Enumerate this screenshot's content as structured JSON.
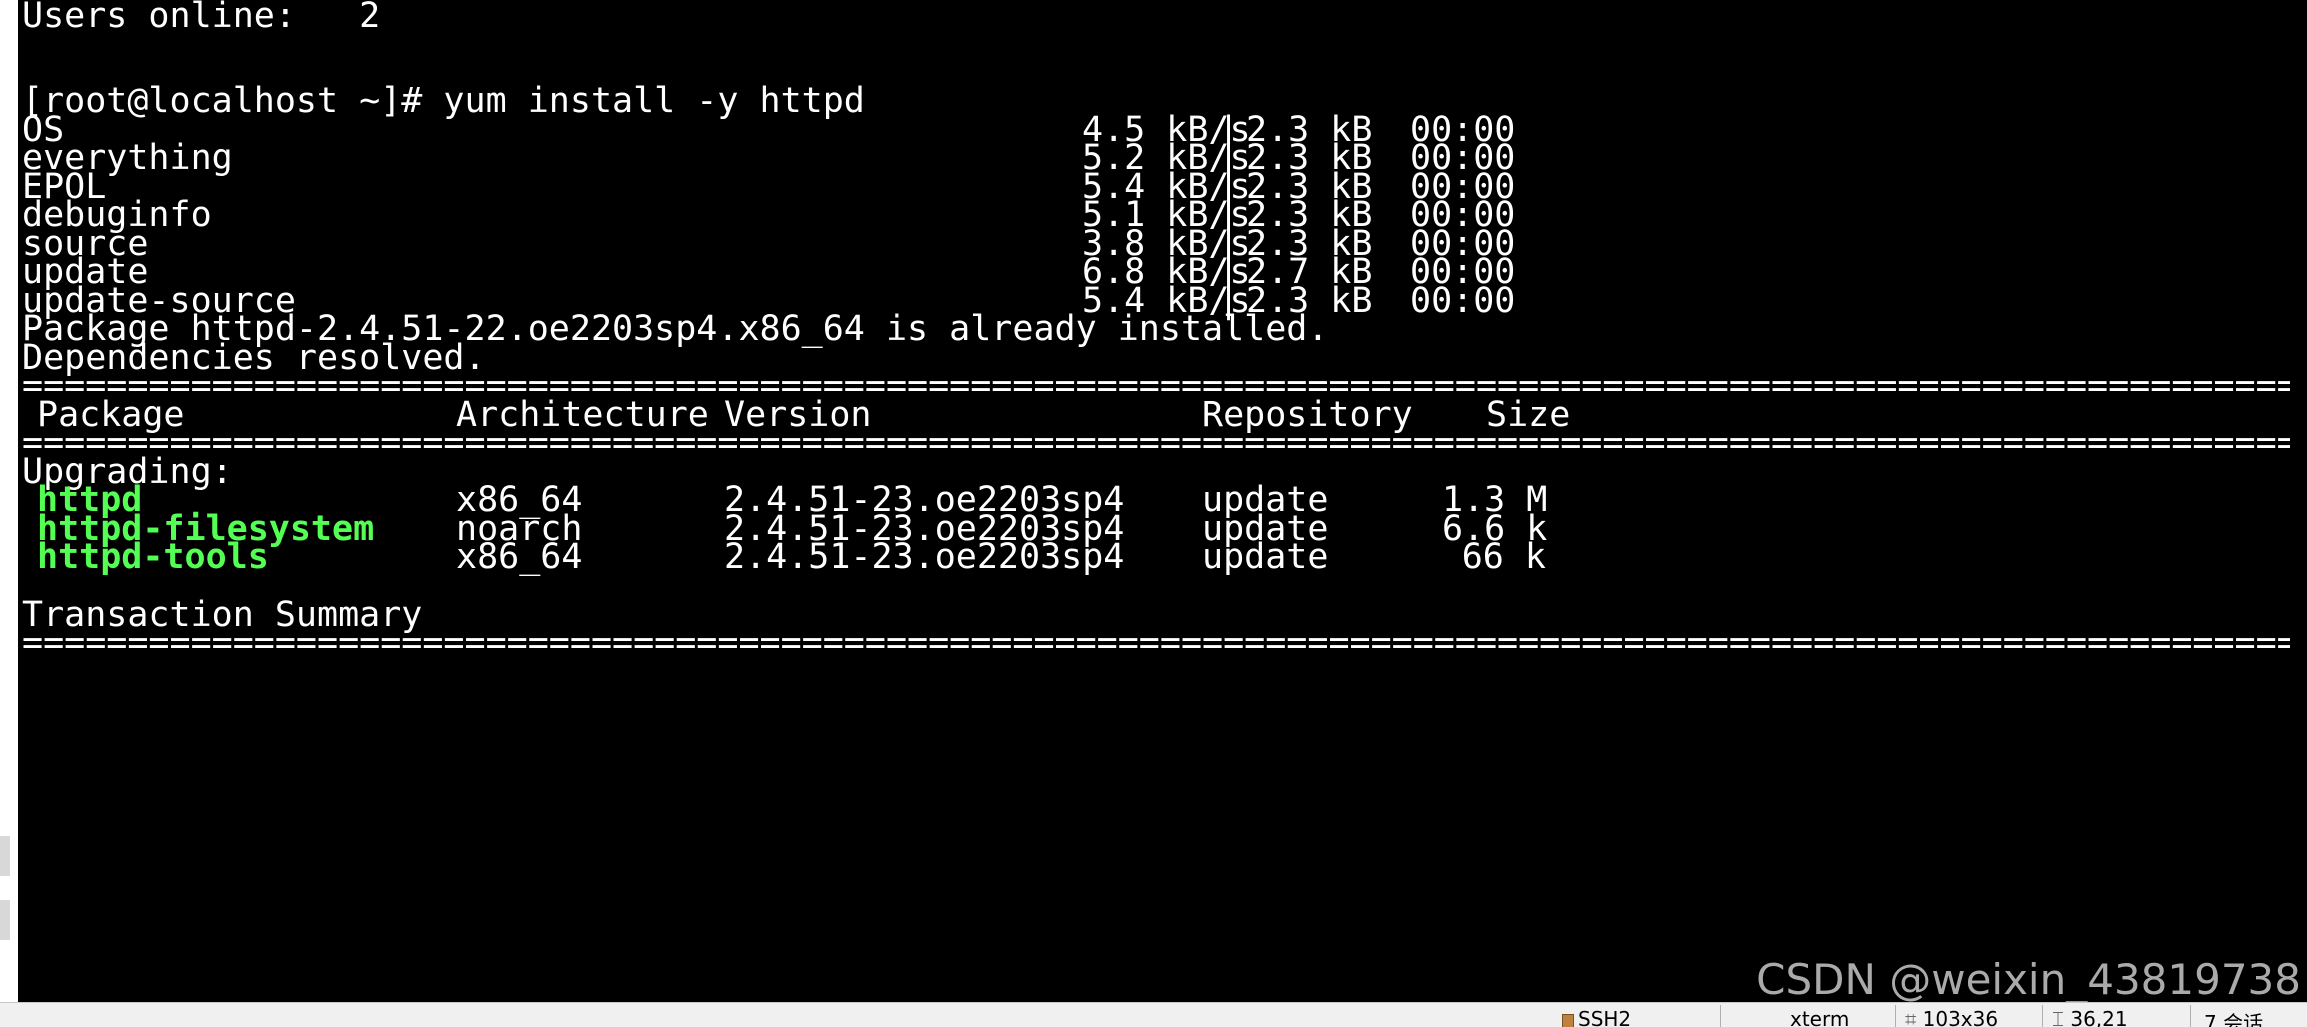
{
  "terminal": {
    "users_online": "Users online:   2",
    "prompt": "[root@localhost ~]# yum install -y httpd",
    "repos": [
      {
        "name": "OS",
        "speed": "4.5 kB/s",
        "size": "2.3 kB",
        "time": "00:00"
      },
      {
        "name": "everything",
        "speed": "5.2 kB/s",
        "size": "2.3 kB",
        "time": "00:00"
      },
      {
        "name": "EPOL",
        "speed": "5.4 kB/s",
        "size": "2.3 kB",
        "time": "00:00"
      },
      {
        "name": "debuginfo",
        "speed": "5.1 kB/s",
        "size": "2.3 kB",
        "time": "00:00"
      },
      {
        "name": "source",
        "speed": "3.8 kB/s",
        "size": "2.3 kB",
        "time": "00:00"
      },
      {
        "name": "update",
        "speed": "6.8 kB/s",
        "size": "2.7 kB",
        "time": "00:00"
      },
      {
        "name": "update-source",
        "speed": "5.4 kB/s",
        "size": "2.3 kB",
        "time": "00:00"
      }
    ],
    "separator": "|",
    "already_installed": "Package httpd-2.4.51-22.oe2203sp4.x86_64 is already installed.",
    "deps_resolved": "Dependencies resolved.",
    "rule": "==================================================================================================================",
    "table_headers": {
      "package": "Package",
      "architecture": "Architecture",
      "version": "Version",
      "repository": "Repository",
      "size": "Size"
    },
    "upgrading_label": "Upgrading:",
    "packages": [
      {
        "name": "httpd",
        "arch": "x86_64",
        "version": "2.4.51-23.oe2203sp4",
        "repo": "update",
        "size": "1.3 M"
      },
      {
        "name": "httpd-filesystem",
        "arch": "noarch",
        "version": "2.4.51-23.oe2203sp4",
        "repo": "update",
        "size": "6.6 k"
      },
      {
        "name": "httpd-tools",
        "arch": "x86_64",
        "version": "2.4.51-23.oe2203sp4",
        "repo": "update",
        "size": "66 k"
      }
    ],
    "transaction_summary": "Transaction Summary"
  },
  "watermark": "CSDN @weixin_43819738",
  "statusbar": {
    "ssh": "SSH2",
    "term_type": "xterm",
    "size": "103x36",
    "position": "36,21",
    "sessions": "7 会话"
  },
  "colors": {
    "background": "#000000",
    "text": "#ffffff",
    "package_name": "#54ff54"
  }
}
